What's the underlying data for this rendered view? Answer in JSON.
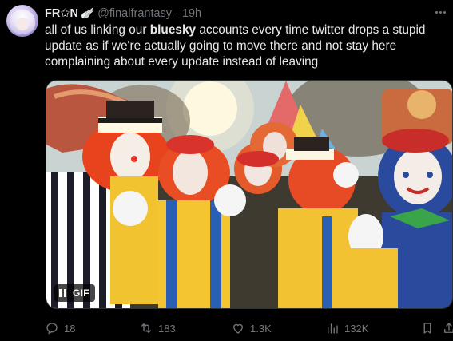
{
  "author": {
    "display_name": "FR✩N",
    "name_emoji": "🪽",
    "handle": "@finalfrantasy",
    "separator": "·",
    "time": "19h"
  },
  "tweet": {
    "text_before": "all of us linking our ",
    "text_bold": "bluesky",
    "text_after": " accounts every time twitter drops a stupid update as if we're actually going to move there and not stay here complaining about every update instead of leaving"
  },
  "media": {
    "type": "gif",
    "gif_label": "GIF"
  },
  "actions": {
    "replies": "18",
    "retweets": "183",
    "likes": "1.3K",
    "views": "132K"
  },
  "icons": {
    "reply": "reply-icon",
    "retweet": "retweet-icon",
    "like": "heart-icon",
    "views": "views-icon",
    "bookmark": "bookmark-icon",
    "share": "share-icon",
    "more": "more-icon",
    "pause": "pause-icon"
  },
  "colors": {
    "background": "#000000",
    "text": "#e7e9ea",
    "muted": "#71767b",
    "border": "#2f3336"
  }
}
